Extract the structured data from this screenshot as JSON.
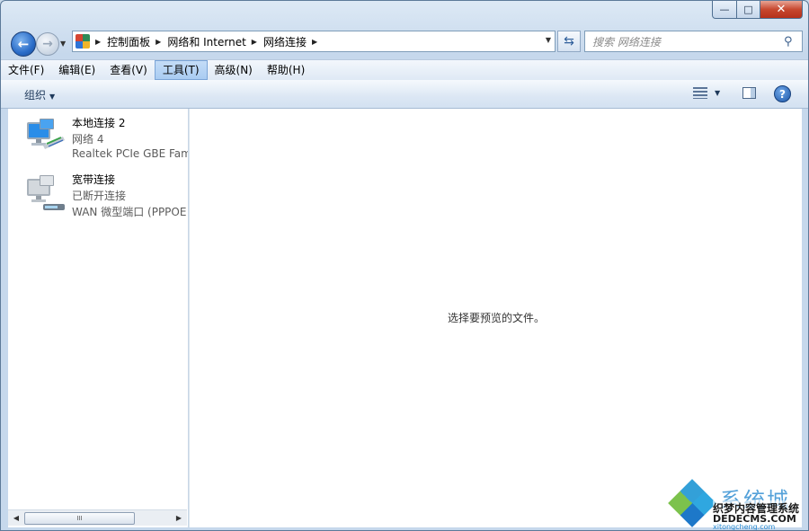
{
  "window": {
    "controls": {
      "minimize": "—",
      "maximize": "□",
      "close": "✕"
    }
  },
  "address": {
    "crumbs": [
      "控制面板",
      "网络和 Internet",
      "网络连接"
    ],
    "search_placeholder": "搜索 网络连接"
  },
  "menu": {
    "items": [
      "文件(F)",
      "编辑(E)",
      "查看(V)",
      "工具(T)",
      "高级(N)",
      "帮助(H)"
    ],
    "active_index": 3
  },
  "toolbar": {
    "organize_label": "组织"
  },
  "connections": [
    {
      "name": "本地连接 2",
      "status": "网络  4",
      "device": "Realtek PCIe GBE Fam",
      "icon": "network-connected-icon"
    },
    {
      "name": "宽带连接",
      "status": "已断开连接",
      "device": "WAN 微型端口 (PPPOE",
      "icon": "broadband-disconnected-icon"
    }
  ],
  "preview": {
    "empty_text": "选择要预览的文件。"
  },
  "scrollbar": {
    "thumb_grip": "III"
  },
  "watermark": {
    "title": "系统城",
    "subtitle": "织梦内容管理系统",
    "url": "DEDECMS.COM",
    "url2": "xitongcheng.com"
  },
  "colors": {
    "accent": "#2a6cc8",
    "menu_active": "#a9ccf2",
    "close_button": "#c7482f"
  }
}
